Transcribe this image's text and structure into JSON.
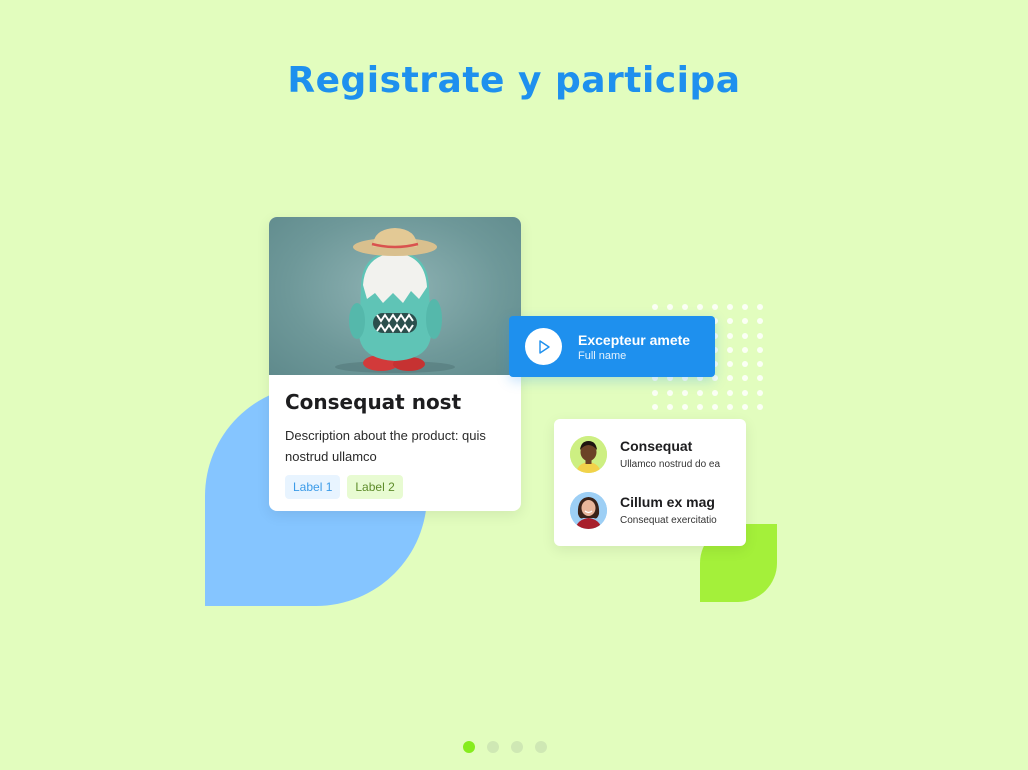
{
  "page": {
    "title": "Registrate y participa"
  },
  "product_card": {
    "title": "Consequat nost",
    "description": "Description about the product: quis nostrud ullamco",
    "tags": [
      "Label 1",
      "Label 2"
    ]
  },
  "video_card": {
    "title": "Excepteur amete",
    "subtitle": "Full name",
    "icon": "play-icon"
  },
  "people": [
    {
      "name": "Consequat",
      "description": "Ullamco nostrud do ea"
    },
    {
      "name": "Cillum ex mag",
      "description": "Consequat exercitatio"
    }
  ],
  "pager": {
    "count": 4,
    "active_index": 0
  },
  "colors": {
    "background": "#e2fdbe",
    "accent_blue": "#1e90ee",
    "accent_green": "#86ec1e",
    "light_blue_shape": "#85c5ff",
    "green_shape": "#a4f03a"
  }
}
